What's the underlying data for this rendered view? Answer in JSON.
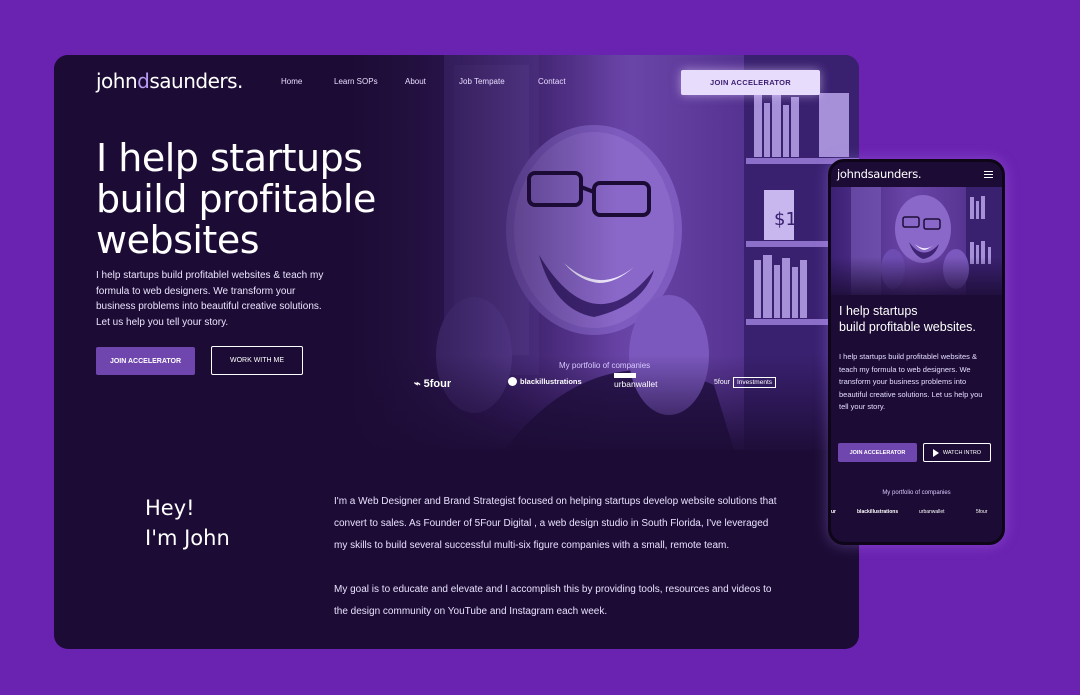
{
  "desktop": {
    "logo": {
      "part1": "john",
      "part2": "d",
      "part3": "saunders."
    },
    "nav": [
      {
        "label": "Home"
      },
      {
        "label": "Learn SOPs"
      },
      {
        "label": "About"
      },
      {
        "label": "Job Tempate"
      },
      {
        "label": "Contact"
      }
    ],
    "top_cta": "JOIN ACCELERATOR",
    "headline": [
      "I help startups",
      "build profitable",
      "websites"
    ],
    "subtext": "I help startups build profitablel websites & teach my formula to web designers. We transform your business problems into beautiful creative solutions. Let us help you tell your story.",
    "primary_button": "JOIN ACCELERATOR",
    "secondary_button": "WORK WITH ME",
    "portfolio_label": "My portfolio of companies",
    "portfolio_logos": [
      {
        "name": "5four"
      },
      {
        "name": "blackillustrations"
      },
      {
        "name": "urbanwallet"
      },
      {
        "name": "5four",
        "tag": "Investments"
      }
    ],
    "intro": {
      "line1": "Hey!",
      "line2": "I'm John"
    },
    "about": [
      "I'm a Web Designer and Brand Strategist focused on helping startups develop website solutions that convert to sales.  As Founder of 5Four Digital , a web design studio in South Florida, I've leveraged my skills to build several successful multi-six figure companies with a small, remote team.",
      "My goal is to educate and elevate and I accomplish this by providing tools, resources and videos to the design community on YouTube and Instagram each week."
    ]
  },
  "mobile": {
    "logo": "johndsaunders.",
    "headline": [
      "I help startups",
      "build profitable websites."
    ],
    "subtext": "I help startups build profitablel websites & teach my formula to web designers. We transform your business problems into beautiful creative solutions. Let us help you tell your story.",
    "primary_button": "JOIN ACCELERATOR",
    "secondary_button": "WATCH INTRO",
    "portfolio_label": "My portfolio of companies",
    "portfolio_logos": [
      "ur",
      "blackillustrations",
      "urbanwallet",
      "5four"
    ]
  },
  "colors": {
    "background": "#6a22b0",
    "panel": "#1c0c35",
    "accent": "#6f46ad",
    "light_cta": "#e7dcfb"
  }
}
